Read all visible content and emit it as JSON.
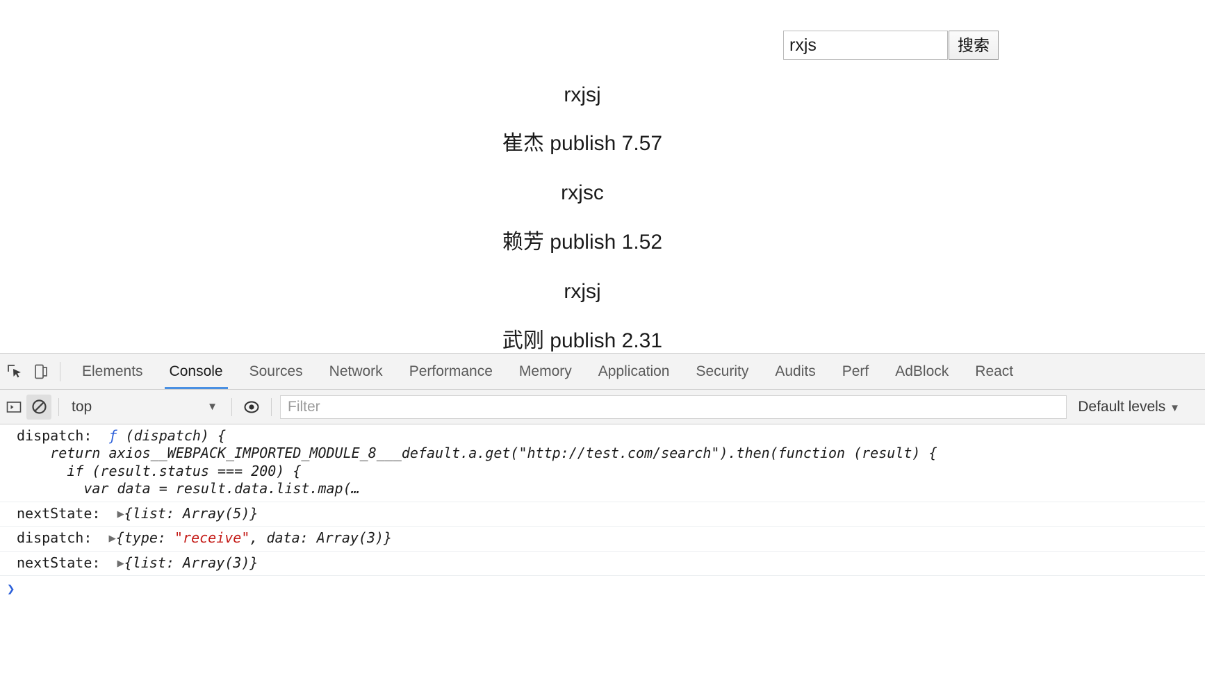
{
  "page": {
    "search": {
      "value": "rxjs",
      "placeholder": "",
      "button_label": "搜索"
    },
    "results": [
      {
        "text": "rxjsj"
      },
      {
        "text": "崔杰 publish 7.57"
      },
      {
        "text": "rxjsc"
      },
      {
        "text": "赖芳 publish 1.52"
      },
      {
        "text": "rxjsj"
      },
      {
        "text": "武刚 publish 2.31"
      }
    ]
  },
  "devtools": {
    "tabs": [
      {
        "label": "Elements",
        "active": false
      },
      {
        "label": "Console",
        "active": true
      },
      {
        "label": "Sources",
        "active": false
      },
      {
        "label": "Network",
        "active": false
      },
      {
        "label": "Performance",
        "active": false
      },
      {
        "label": "Memory",
        "active": false
      },
      {
        "label": "Application",
        "active": false
      },
      {
        "label": "Security",
        "active": false
      },
      {
        "label": "Audits",
        "active": false
      },
      {
        "label": "Perf",
        "active": false
      },
      {
        "label": "AdBlock",
        "active": false
      },
      {
        "label": "React",
        "active": false
      }
    ],
    "icons": {
      "inspect": "inspect-element-icon",
      "device": "device-toolbar-icon",
      "sidebar": "console-sidebar-icon",
      "clear": "clear-console-icon",
      "eye": "live-expression-icon"
    },
    "filterbar": {
      "context": "top",
      "context_caret": "▼",
      "filter_placeholder": "Filter",
      "filter_value": "",
      "levels_label": "Default levels",
      "levels_caret": "▼"
    },
    "console": {
      "entries": [
        {
          "label": "dispatch:",
          "fn_glyph": "ƒ",
          "lines": [
            " (dispatch) {",
            "    return axios__WEBPACK_IMPORTED_MODULE_8___default.a.get(\"http://test.com/search\").then(function (result) {",
            "      if (result.status === 200) {",
            "        var data = result.data.list.map(…"
          ]
        },
        {
          "label": "nextState:",
          "triangle": "▶",
          "value": "{list: Array(5)}"
        },
        {
          "label": "dispatch:",
          "triangle": "▶",
          "value_pre": "{type: ",
          "value_str": "\"receive\"",
          "value_post": ", data: Array(3)}"
        },
        {
          "label": "nextState:",
          "triangle": "▶",
          "value": "{list: Array(3)}"
        }
      ],
      "prompt": "❯"
    }
  },
  "colors": {
    "accent": "#4a90e2",
    "string_red": "#c41a16",
    "function_blue": "#2b5fd9",
    "toolbar_bg": "#f3f3f3"
  }
}
